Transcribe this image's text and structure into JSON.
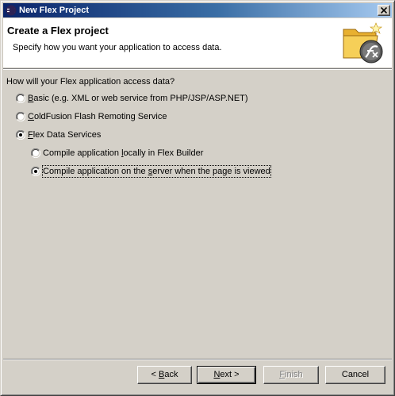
{
  "window": {
    "title": "New Flex Project",
    "title_icon": "eclipse-icon",
    "close_icon": "close-icon"
  },
  "banner": {
    "title": "Create a Flex project",
    "description": "Specify how you want your application to access data.",
    "logo_icon": "flex-folder-icon"
  },
  "question": "How will your Flex application access data?",
  "options": [
    {
      "pre": "",
      "key": "B",
      "post": "asic (e.g. XML or web service from PHP/JSP/ASP.NET)",
      "selected": false
    },
    {
      "pre": "",
      "key": "C",
      "post": "oldFusion Flash Remoting Service",
      "selected": false
    },
    {
      "pre": "",
      "key": "F",
      "post": "lex Data Services",
      "selected": true
    }
  ],
  "sub_options": [
    {
      "pre": "Compile application ",
      "key": "l",
      "post": "ocally in Flex Builder",
      "selected": false
    },
    {
      "pre": "Compile application on the ",
      "key": "s",
      "post": "erver when the page is viewed",
      "selected": true
    }
  ],
  "buttons": {
    "back": {
      "pre": "< ",
      "key": "B",
      "post": "ack",
      "enabled": true
    },
    "next": {
      "pre": "",
      "key": "N",
      "post": "ext >",
      "enabled": true
    },
    "finish": {
      "pre": "",
      "key": "F",
      "post": "inish",
      "enabled": false
    },
    "cancel": {
      "label": "Cancel",
      "enabled": true
    }
  }
}
